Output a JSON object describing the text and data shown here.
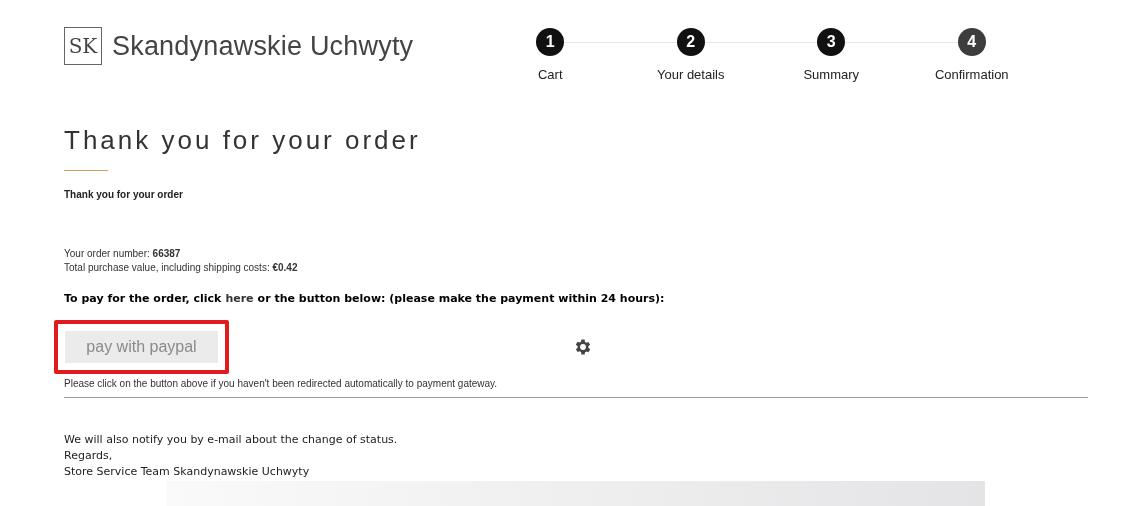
{
  "logo": {
    "mark": "SK",
    "name": "Skandynawskie Uchwyty"
  },
  "steps": [
    {
      "number": "1",
      "label": "Cart",
      "selected": false
    },
    {
      "number": "2",
      "label": "Your details",
      "selected": false
    },
    {
      "number": "3",
      "label": "Summary",
      "selected": false
    },
    {
      "number": "4",
      "label": "Confirmation",
      "selected": true
    }
  ],
  "heading": "Thank you for your order",
  "subheading": "Thank you for your order",
  "order_number": "Your order number: **66387**",
  "total": "Total purchase value, including shipping costs: **€0.42**",
  "pay_prompt": {
    "before": "To pay for the order, click",
    "link": "here",
    "after": "or the button below: (please make the payment within 24 hours):"
  },
  "pay_button": {
    "label": "pay with paypal",
    "highlighted": true
  },
  "redirect_note": "Please click on the button above if you haven't been redirected automatically to payment gateway.",
  "footer_lines": [
    "We will also notify you by e-mail about the change of status.",
    "Regards,",
    "Store Service Team Skandynawskie Uchwyty"
  ]
}
